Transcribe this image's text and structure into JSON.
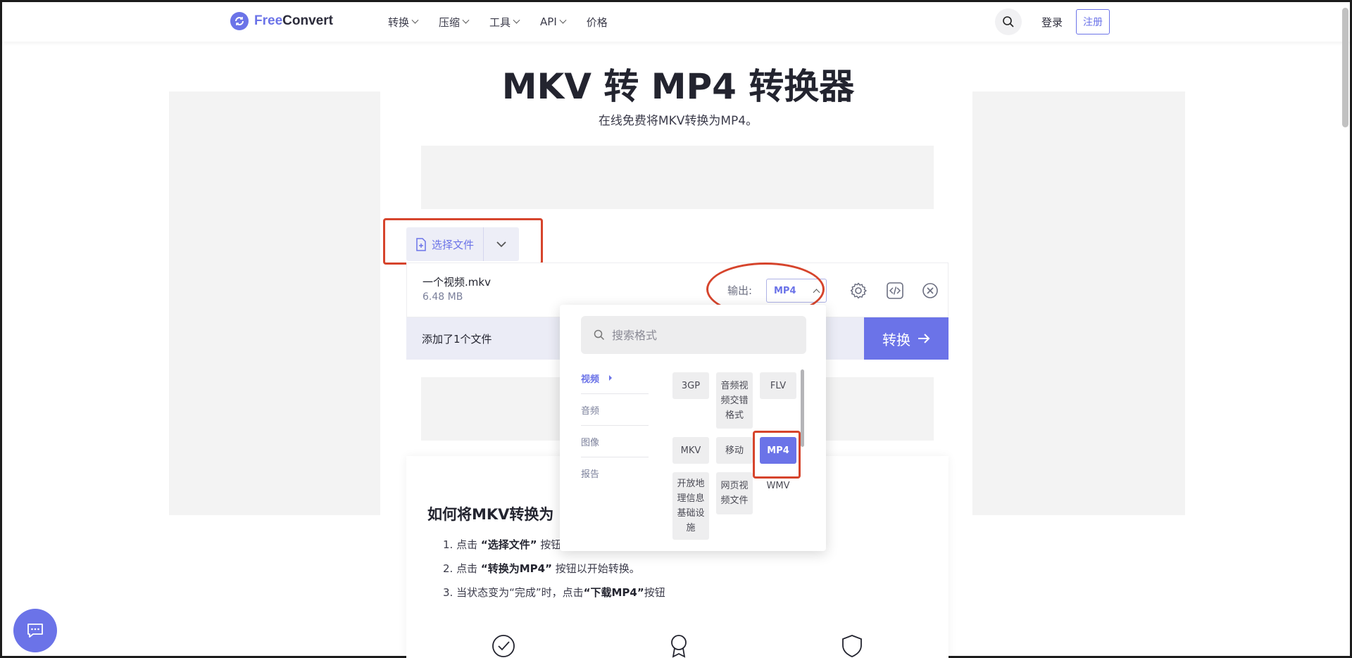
{
  "header": {
    "logo_free": "Free",
    "logo_convert": "Convert",
    "nav": [
      "转换",
      "压缩",
      "工具",
      "API",
      "价格"
    ],
    "login": "登录",
    "register": "注册"
  },
  "hero": {
    "title": "MKV 转 MP4 转换器",
    "subtitle": "在线免费将MKV转换为MP4。"
  },
  "upload": {
    "choose_label": "选择文件",
    "file_name": "一个视频.mkv",
    "file_size": "6.48 MB",
    "output_label": "输出:",
    "output_value": "MP4",
    "status": "添加了1个文件",
    "convert_label": "转换"
  },
  "dropdown": {
    "search_placeholder": "搜索格式",
    "categories": [
      "视频",
      "音频",
      "图像",
      "报告"
    ],
    "formats": {
      "f1": "3GP",
      "f2": "音频视频交错格式",
      "f3": "FLV",
      "f4": "MKV",
      "f5": "移动",
      "f6": "MP4",
      "f7": "开放地理信息基础设施",
      "f8": "网页视频文件",
      "f9": "WMV"
    }
  },
  "howto": {
    "title": "如何将MKV转换为",
    "step1_pre": "1. 点击 ",
    "step1_bold": "“选择文件”",
    "step1_post": " 按钮",
    "step2_pre": "2. 点击 ",
    "step2_bold": "“转换为MP4”",
    "step2_post": " 按钮以开始转换。",
    "step3_pre": "3. 当状态变为“完成”时，点击",
    "step3_bold": "“下载MP4”",
    "step3_post": "按钮"
  },
  "colors": {
    "accent": "#6b73e8",
    "annotation_red": "#d6442c"
  }
}
